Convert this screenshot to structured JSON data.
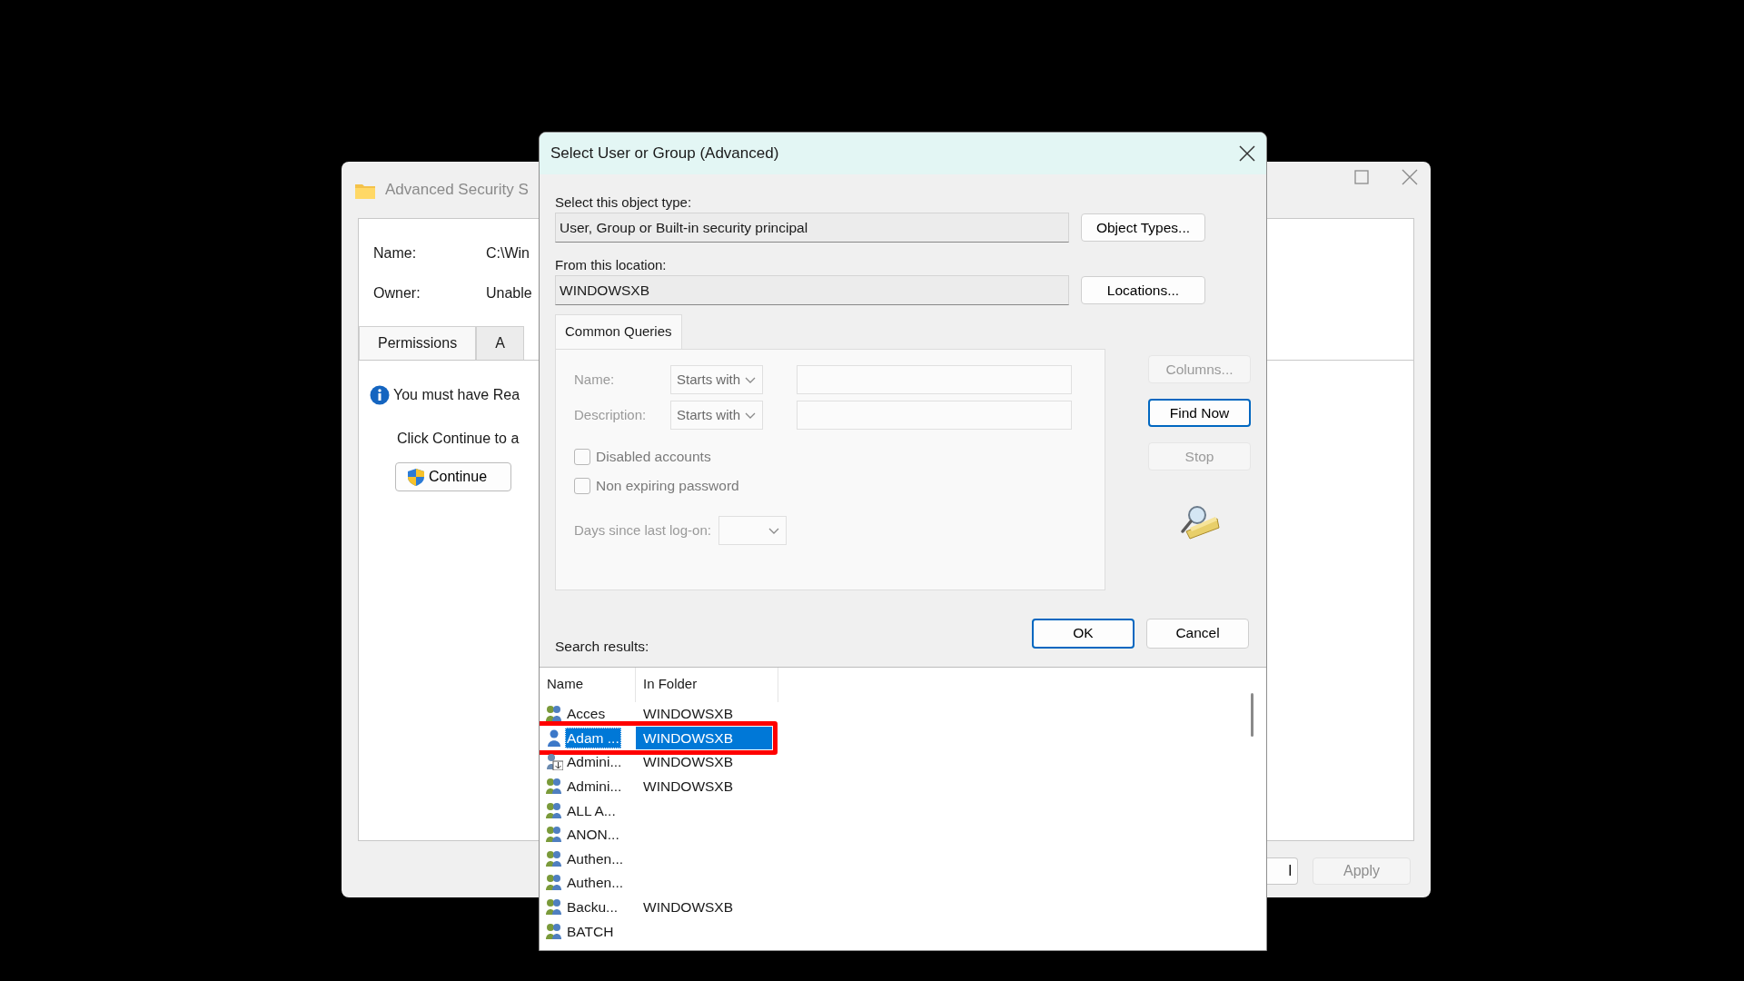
{
  "background_window": {
    "title": "Advanced Security S",
    "fields": [
      {
        "label": "Name:",
        "value": "C:\\Win"
      },
      {
        "label": "Owner:",
        "value": "Unable"
      }
    ],
    "tabs": [
      {
        "label": "Permissions",
        "selected": true
      },
      {
        "label": "A",
        "selected": false
      }
    ],
    "info": "You must have Rea",
    "instruction": "Click Continue to a",
    "continue_button": "Continue",
    "footer_buttons": [
      {
        "label": "l",
        "disabled": false
      },
      {
        "label": "Apply",
        "disabled": true
      }
    ]
  },
  "dialog": {
    "title": "Select User or Group (Advanced)",
    "object_type": {
      "label": "Select this object type:",
      "value": "User, Group or Built-in security principal",
      "button": "Object Types..."
    },
    "location": {
      "label": "From this location:",
      "value": "WINDOWSXB",
      "button": "Locations..."
    },
    "query_tab": "Common Queries",
    "queries": [
      {
        "label": "Name:",
        "operator": "Starts with",
        "disabled": true
      },
      {
        "label": "Description:",
        "operator": "Starts with",
        "disabled": true
      }
    ],
    "checkboxes": [
      {
        "label": "Disabled accounts",
        "checked": false
      },
      {
        "label": "Non expiring password",
        "checked": false
      }
    ],
    "days_label": "Days since last log-on:",
    "side_buttons": [
      {
        "label": "Columns...",
        "disabled": true,
        "default": false
      },
      {
        "label": "Find Now",
        "disabled": false,
        "default": true
      },
      {
        "label": "Stop",
        "disabled": true,
        "default": false
      }
    ],
    "buttons": [
      {
        "label": "OK",
        "default": true
      },
      {
        "label": "Cancel",
        "default": false
      }
    ],
    "results_label": "Search results:",
    "results": {
      "columns": [
        "Name",
        "In Folder"
      ],
      "rows": [
        {
          "kind": "group",
          "name": "Acces",
          "folder": "WINDOWSXB",
          "selected": false,
          "annotated": false
        },
        {
          "kind": "user",
          "name": "Adam ...",
          "folder": "WINDOWSXB",
          "selected": true,
          "annotated": true
        },
        {
          "kind": "user-arrow",
          "name": "Admini...",
          "folder": "WINDOWSXB",
          "selected": false,
          "annotated": false
        },
        {
          "kind": "group",
          "name": "Admini...",
          "folder": "WINDOWSXB",
          "selected": false,
          "annotated": false
        },
        {
          "kind": "group",
          "name": "ALL A...",
          "selected": false,
          "annotated": false
        },
        {
          "kind": "group",
          "name": "ANON...",
          "selected": false,
          "annotated": false
        },
        {
          "kind": "group",
          "name": "Authen...",
          "selected": false,
          "annotated": false
        },
        {
          "kind": "group",
          "name": "Authen...",
          "selected": false,
          "annotated": false
        },
        {
          "kind": "group",
          "name": "Backu...",
          "folder": "WINDOWSXB",
          "selected": false,
          "annotated": false
        },
        {
          "kind": "group",
          "name": "BATCH",
          "selected": false,
          "annotated": false
        }
      ]
    }
  }
}
